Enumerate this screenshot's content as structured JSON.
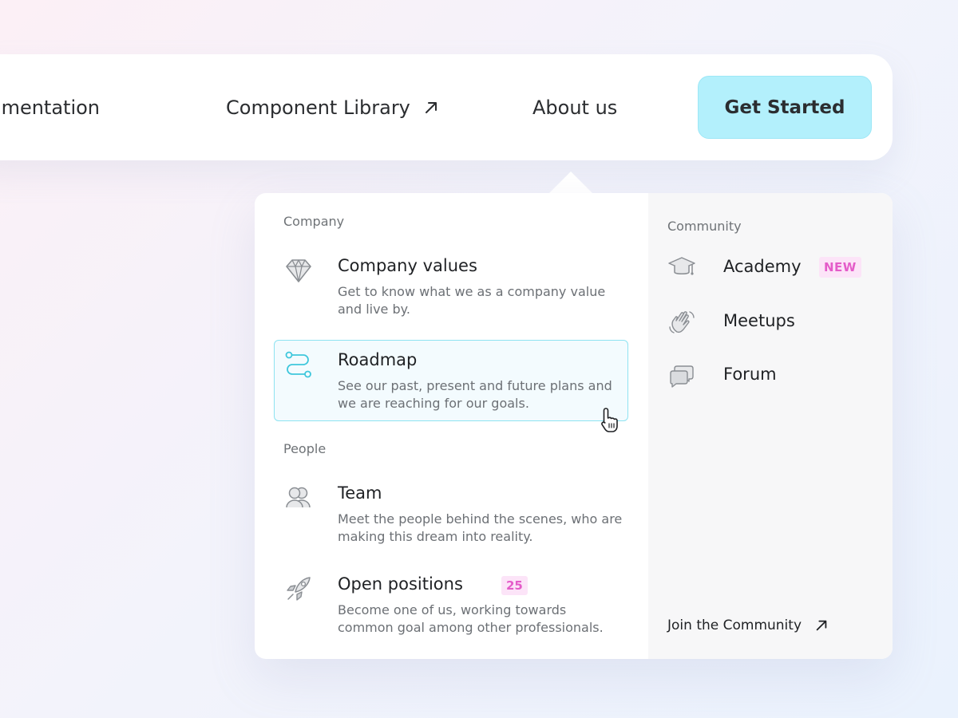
{
  "nav": {
    "items": [
      {
        "label": "Documentation"
      },
      {
        "label": "Component Library",
        "icon": "external-arrow-icon"
      },
      {
        "label": "About us"
      }
    ],
    "cta_label": "Get Started"
  },
  "dropdown": {
    "company": {
      "heading": "Company",
      "items": [
        {
          "title": "Company values",
          "desc": "Get to know what we as a company value and live by.",
          "icon": "diamond-icon"
        },
        {
          "title": "Roadmap",
          "desc": "See our past, present and future plans and we are reaching for our goals.",
          "icon": "roadmap-icon",
          "active": true
        }
      ]
    },
    "people": {
      "heading": "People",
      "items": [
        {
          "title": "Team",
          "desc": "Meet the people behind the scenes, who are making this dream into reality.",
          "icon": "team-icon"
        },
        {
          "title": "Open positions",
          "desc": "Become one of us, working towards common goal among other professionals.",
          "badge": "25",
          "icon": "rocket-icon"
        }
      ]
    },
    "community": {
      "heading": "Community",
      "items": [
        {
          "label": "Academy",
          "badge": "NEW",
          "icon": "graduation-cap-icon"
        },
        {
          "label": "Meetups",
          "icon": "waving-hand-icon"
        },
        {
          "label": "Forum",
          "icon": "chat-bubbles-icon"
        }
      ],
      "join_label": "Join the Community"
    }
  },
  "colors": {
    "cta_bg": "#b3f0fc",
    "active_border": "#8ee3f1",
    "active_bg": "#f3fbfe",
    "badge_bg": "#fce4f8",
    "badge_text": "#e45cc9",
    "roadmap_icon": "#3fc7dc"
  }
}
